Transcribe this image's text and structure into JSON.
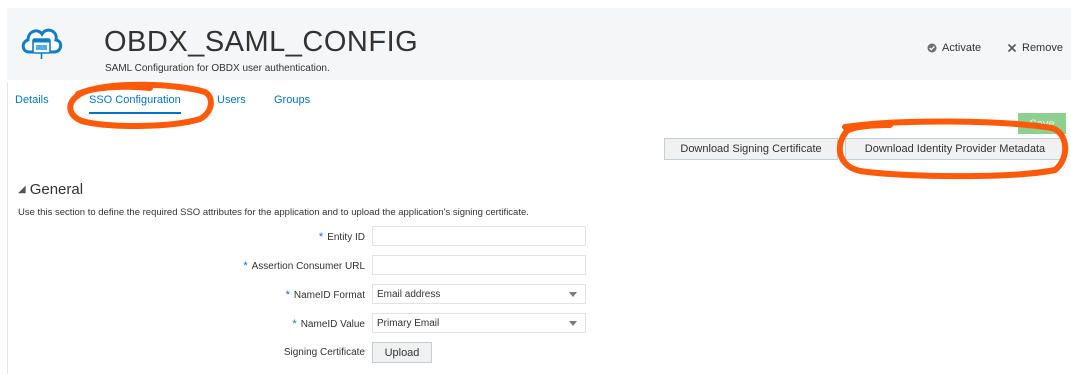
{
  "header": {
    "title": "OBDX_SAML_CONFIG",
    "subtitle": "SAML Configuration for OBDX user authentication.",
    "activate_label": "Activate",
    "remove_label": "Remove"
  },
  "tabs": [
    {
      "label": "Details",
      "active": false
    },
    {
      "label": "SSO Configuration",
      "active": true
    },
    {
      "label": "Users",
      "active": false
    },
    {
      "label": "Groups",
      "active": false
    }
  ],
  "toolbar": {
    "save_label": "Save",
    "download_signing_label": "Download Signing Certificate",
    "download_idp_label": "Download Identity Provider Metadata"
  },
  "general": {
    "heading": "General",
    "description": "Use this section to define the required SSO attributes for the application and to upload the application's signing certificate.",
    "required_mark": "*",
    "fields": {
      "entity_id": {
        "label": "Entity ID",
        "value": ""
      },
      "assertion_url": {
        "label": "Assertion Consumer URL",
        "value": ""
      },
      "nameid_format": {
        "label": "NameID Format",
        "value": "Email address"
      },
      "nameid_value": {
        "label": "NameID Value",
        "value": "Primary Email"
      },
      "signing_cert": {
        "label": "Signing Certificate",
        "button": "Upload"
      }
    }
  },
  "colors": {
    "link_blue": "#0572ce",
    "header_bg": "#f5f6f7",
    "save_green": "#8fcf8f",
    "annotation_orange": "#ff5a0a"
  },
  "icons": {
    "app": "cloud-app-icon",
    "activate": "check-circle-icon",
    "remove": "x-icon",
    "section_toggle": "triangle-down-icon"
  }
}
